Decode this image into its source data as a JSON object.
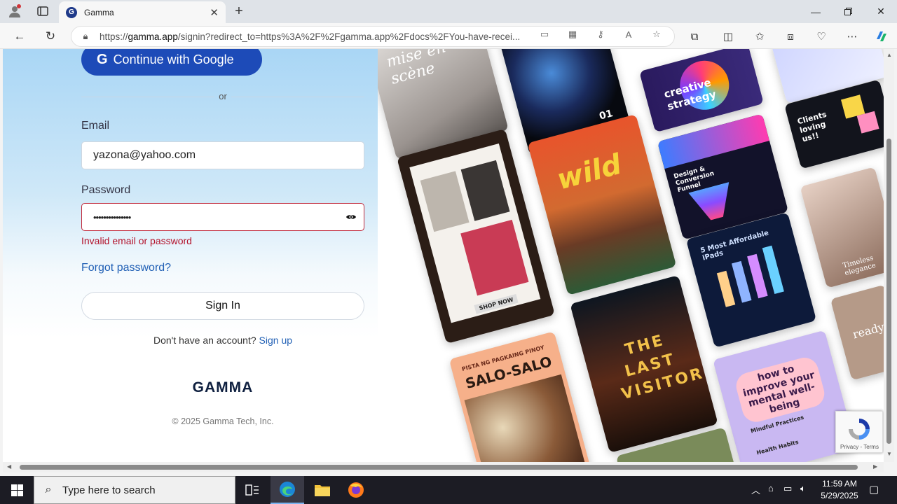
{
  "browser": {
    "tab_title": "Gamma",
    "url_prefix": "https://",
    "url_host": "gamma.app",
    "url_rest": "/signin?redirect_to=https%3A%2F%2Fgamma.app%2Fdocs%2FYou-have-recei..."
  },
  "signin": {
    "google_label": "Continue with Google",
    "or_text": "or",
    "email_label": "Email",
    "email_value": "yazona@yahoo.com",
    "password_label": "Password",
    "password_value": "•••••••••••••••",
    "error_text": "Invalid email or password",
    "forgot_label": "Forgot password?",
    "signin_label": "Sign In",
    "no_account_text": "Don't have an account?",
    "signup_label": "Sign up",
    "logo_text": "GAMMA",
    "copyright": "© 2025 Gamma Tech, Inc."
  },
  "gallery": {
    "card_mise": "mise en scène",
    "card_01": "01",
    "card_strategy": "creative strategy",
    "card_wild": "wild",
    "card_funnel": "Design & Conversion Funnel",
    "card_clients": "Clients loving us!!",
    "card_ipads": "5 Most Affordable iPads",
    "card_last_visitor": "THE LAST VISITOR",
    "card_shop": "SHOP NOW",
    "card_salo_sub": "PISTA NG PAGKAING PINOY",
    "card_salo": "SALO-SALO",
    "card_mental": "how to improve your mental well-being",
    "card_mindful": "Mindful Practices",
    "card_health": "Health Habits",
    "card_timeless": "Timeless elegance",
    "card_ready": "ready"
  },
  "recaptcha": {
    "text": "Privacy - Terms"
  },
  "taskbar": {
    "search_placeholder": "Type here to search",
    "time": "11:59 AM",
    "date": "5/29/2025"
  },
  "colors": {
    "brand_blue": "#1d4bb8",
    "error_red": "#b3132b",
    "link_blue": "#2160b5"
  }
}
